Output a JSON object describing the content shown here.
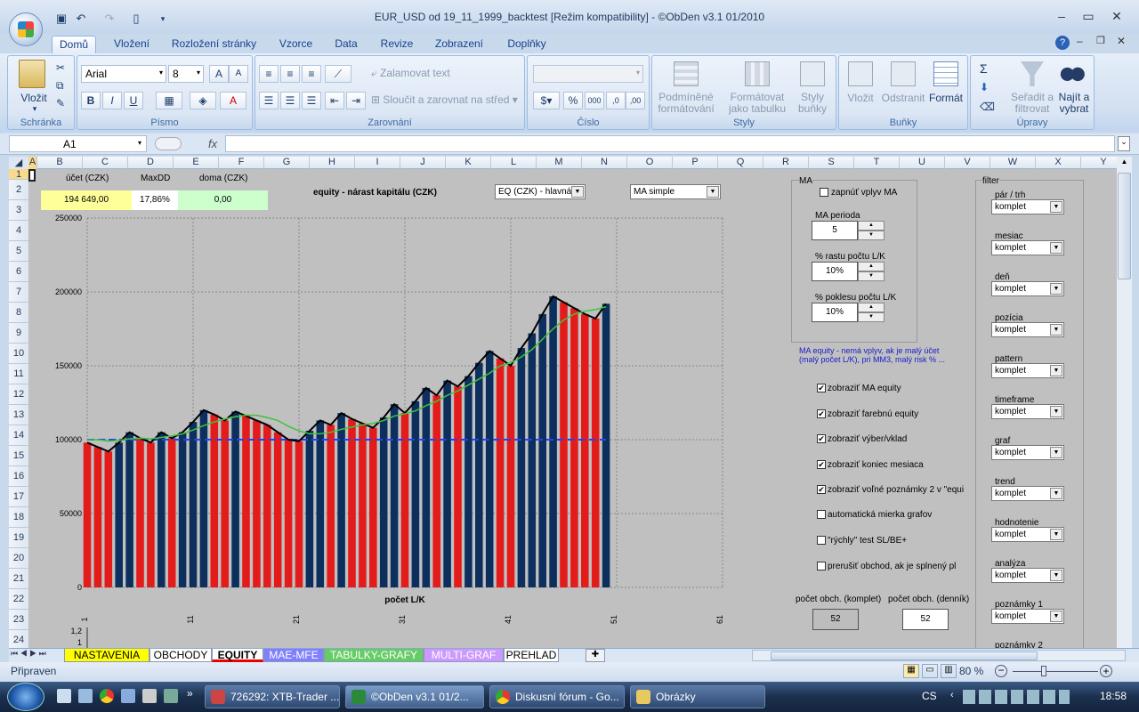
{
  "window": {
    "title": "EUR_USD od 19_11_1999_backtest  [Režim kompatibility]  - ©ObDen v3.1    01/2010"
  },
  "ribbon_tabs": [
    "Domů",
    "Vložení",
    "Rozložení stránky",
    "Vzorce",
    "Data",
    "Revize",
    "Zobrazení",
    "Doplňky"
  ],
  "ribbon": {
    "clipboard": {
      "paste": "Vložit",
      "label": "Schránka"
    },
    "font": {
      "name": "Arial",
      "size": "8",
      "label": "Písmo"
    },
    "alignment": {
      "wrap": "Zalamovat text",
      "merge": "Sloučit a zarovnat na střed",
      "label": "Zarovnání"
    },
    "number": {
      "label": "Číslo",
      "percent": "%",
      "thousands": "000"
    },
    "styles": {
      "cond": "Podmíněné formátování",
      "table": "Formátovat jako tabulku",
      "cell": "Styly buňky",
      "label": "Styly"
    },
    "cells": {
      "insert": "Vložit",
      "delete": "Odstranit",
      "format": "Formát",
      "label": "Buňky"
    },
    "editing": {
      "sort": "Seřadit a filtrovat",
      "find": "Najít a vybrat",
      "label": "Úpravy",
      "sum": "Σ"
    }
  },
  "formula_bar": {
    "name_box": "A1",
    "fx": "fx",
    "formula": ""
  },
  "columns": [
    "A",
    "B",
    "C",
    "D",
    "E",
    "F",
    "G",
    "H",
    "I",
    "J",
    "K",
    "L",
    "M",
    "N",
    "O",
    "P",
    "Q",
    "R",
    "S",
    "T",
    "U",
    "V",
    "W",
    "X",
    "Y"
  ],
  "rows": [
    "1",
    "2",
    "3",
    "4",
    "5",
    "6",
    "7",
    "8",
    "9",
    "10",
    "11",
    "12",
    "13",
    "14",
    "15",
    "16",
    "17",
    "18",
    "19",
    "20",
    "21",
    "22",
    "23",
    "24"
  ],
  "summary": {
    "account_label": "účet (CZK)",
    "account_value": "194 649,00",
    "maxdd_label": "MaxDD",
    "maxdd_value": "17,86%",
    "home_label": "doma (CZK)",
    "home_value": "0,00"
  },
  "chart_title": "equity - nárast kapitálu (CZK)",
  "eq_select": "EQ (CZK) - hlavná",
  "ma_select": "MA simple",
  "chart_data": {
    "type": "bar",
    "title": "equity - nárast kapitálu (CZK)",
    "xlabel": "počet L/K",
    "ylabel": "",
    "ylim": [
      0,
      250000
    ],
    "yticks": [
      "250000",
      "200000",
      "150000",
      "100000",
      "50000",
      "0"
    ],
    "xticks": [
      "1",
      "11",
      "21",
      "31",
      "41",
      "51",
      "61"
    ],
    "xmax": 61,
    "colors": {
      "up": "#0d2f5e",
      "down": "#e41b1b",
      "line": "#000000",
      "ma": "#3cc43c",
      "baseline": "#2244ee",
      "marker": "#f0e040"
    },
    "baseline": 100000,
    "values": [
      98000,
      95000,
      92000,
      98000,
      105000,
      101000,
      98000,
      105000,
      101000,
      105000,
      112000,
      120000,
      117000,
      113000,
      119000,
      116000,
      113000,
      110000,
      105000,
      100000,
      99000,
      106000,
      113000,
      110000,
      118000,
      114000,
      111000,
      108000,
      115000,
      124000,
      118000,
      126000,
      135000,
      130000,
      140000,
      136000,
      143000,
      152000,
      160000,
      155000,
      150000,
      162000,
      172000,
      185000,
      197000,
      193000,
      189000,
      185000,
      182000,
      192000
    ],
    "ma": [
      100000,
      100000,
      99000,
      99500,
      100500,
      101000,
      100500,
      101500,
      102500,
      104000,
      106500,
      109500,
      112000,
      114000,
      115500,
      116500,
      116500,
      115000,
      113000,
      109000,
      106000,
      104000,
      104000,
      105000,
      107000,
      108500,
      110000,
      111000,
      113000,
      116000,
      117500,
      119500,
      123000,
      126000,
      130000,
      133000,
      137000,
      141000,
      145000,
      150000,
      152000,
      156000,
      161000,
      168000,
      175000,
      181000,
      185000,
      187000,
      188000,
      190000
    ]
  },
  "ma_panel": {
    "header": "MA",
    "toggle": "zapnúť vplyv MA",
    "period_label": "MA perioda",
    "period_value": "5",
    "up_label": "% rastu počtu L/K",
    "up_value": "10%",
    "down_label": "% poklesu počtu L/K",
    "down_value": "10%",
    "note": "MA equity - nemá vplyv, ak je malý účet (malý počet L/K), pri MM3, malý risk % ..."
  },
  "options": [
    {
      "label": "zobraziť MA equity",
      "checked": true
    },
    {
      "label": "zobraziť farebnú equity",
      "checked": true
    },
    {
      "label": "zobraziť výber/vklad",
      "checked": true
    },
    {
      "label": "zobraziť koniec mesiaca",
      "checked": true
    },
    {
      "label": "zobraziť voľné poznámky 2 v \"equi",
      "checked": true
    },
    {
      "label": "automatická mierka grafov",
      "checked": false
    },
    {
      "label": "\"rýchly\" test SL/BE+",
      "checked": false
    },
    {
      "label": "prerušiť obchod, ak je splnený pl",
      "checked": false
    }
  ],
  "counts": {
    "total_label": "počet obch. (komplet)",
    "total_value": "52",
    "daily_label": "počet obch. (denník)",
    "daily_value": "52"
  },
  "filter": {
    "header": "filter",
    "items": [
      {
        "label": "pár / trh",
        "value": "komplet"
      },
      {
        "label": "mesiac",
        "value": "komplet"
      },
      {
        "label": "deň",
        "value": "komplet"
      },
      {
        "label": "pozícia",
        "value": "komplet"
      },
      {
        "label": "pattern",
        "value": "komplet"
      },
      {
        "label": "timeframe",
        "value": "komplet"
      },
      {
        "label": "graf",
        "value": "komplet"
      },
      {
        "label": "trend",
        "value": "komplet"
      },
      {
        "label": "hodnotenie",
        "value": "komplet"
      },
      {
        "label": "analýza",
        "value": "komplet"
      },
      {
        "label": "poznámky 1",
        "value": "komplet"
      },
      {
        "label": "poznámky 2",
        "value": ""
      }
    ]
  },
  "second_chart": {
    "ytick_top": "1,2",
    "ytick_next": "1"
  },
  "sheet_tabs": [
    "NASTAVENIA",
    "OBCHODY",
    "EQUITY",
    "MAE-MFE",
    "TABULKY-GRAFY",
    "MULTI-GRAF",
    "PREHLAD"
  ],
  "sheet_tab_colors": [
    "#ffff00",
    "#ffffff",
    "#ffffff",
    "#8080ff",
    "#66cc66",
    "#cc99ff",
    "#ffffff"
  ],
  "status": {
    "ready": "Připraven",
    "zoom": "80 %"
  },
  "taskbar": {
    "items": [
      "726292: XTB-Trader ...",
      "©ObDen v3.1    01/2...",
      "Diskusní fórum - Go...",
      "Obrázky"
    ],
    "lang": "CS",
    "time": "18:58"
  }
}
